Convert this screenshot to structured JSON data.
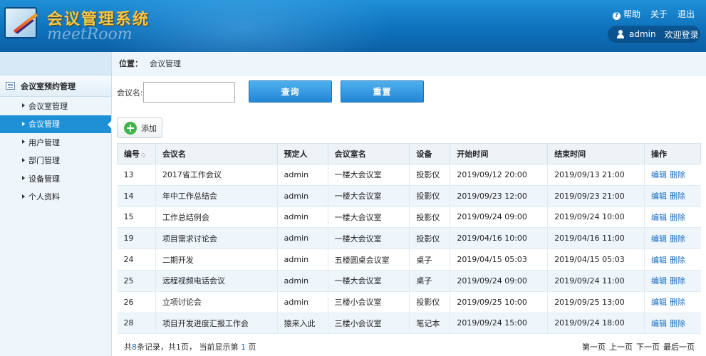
{
  "header": {
    "title": "会议管理系统",
    "subtitle": "meetRoom",
    "help": "帮助",
    "about": "关于",
    "logout": "退出",
    "username": "admin",
    "welcome": "欢迎登录"
  },
  "sidebar": {
    "section": "会议室预约管理",
    "items": [
      {
        "label": "会议室管理"
      },
      {
        "label": "会议管理",
        "active": true
      },
      {
        "label": "用户管理"
      },
      {
        "label": "部门管理"
      },
      {
        "label": "设备管理"
      },
      {
        "label": "个人资料"
      }
    ]
  },
  "main": {
    "crumb_label": "位置：",
    "crumb_value": "会议管理",
    "search_label": "会议名:",
    "search_value": "",
    "query_button": "查询",
    "reset_button": "重置",
    "add_button": "添加"
  },
  "table": {
    "headers": [
      "编号",
      "会议名",
      "预定人",
      "会议室名",
      "设备",
      "开始时间",
      "结束时间",
      "操作"
    ],
    "rows": [
      [
        "13",
        "2017省工作会议",
        "admin",
        "一楼大会议室",
        "投影仪",
        "2019/09/12 20:00",
        "2019/09/13 21:00"
      ],
      [
        "14",
        "年中工作总结会",
        "admin",
        "一楼大会议室",
        "投影仪",
        "2019/09/23 12:00",
        "2019/09/23 21:00"
      ],
      [
        "15",
        "工作总结例会",
        "admin",
        "一楼大会议室",
        "投影仪",
        "2019/09/24 09:00",
        "2019/09/24 10:00"
      ],
      [
        "19",
        "项目需求讨论会",
        "admin",
        "一楼大会议室",
        "投影仪",
        "2019/04/16 10:00",
        "2019/04/16 11:00"
      ],
      [
        "24",
        "二期开发",
        "admin",
        "五楼圆桌会议室",
        "桌子",
        "2019/04/15 05:03",
        "2019/04/15 05:03"
      ],
      [
        "25",
        "远程视频电话会议",
        "admin",
        "一楼大会议室",
        "桌子",
        "2019/09/24 09:00",
        "2019/09/24 11:00"
      ],
      [
        "26",
        "立项讨论会",
        "admin",
        "三楼小会议室",
        "投影仪",
        "2019/09/25 10:00",
        "2019/09/25 13:00"
      ],
      [
        "28",
        "项目开发进度汇报工作会",
        "猿来入此",
        "三楼小会议室",
        "笔记本",
        "2019/09/24 15:00",
        "2019/09/24 18:00"
      ]
    ],
    "edit_label": "编辑",
    "delete_label": "删除"
  },
  "pager": {
    "summary_prefix": "共",
    "total": "8",
    "summary_mid": "条记录，共1页，",
    "current_prefix": "当前显示第",
    "current": "1",
    "current_suffix": "页",
    "first": "第一页",
    "prev": "上一页",
    "next": "下一页",
    "last": "最后一页"
  },
  "colors": {
    "accent": "#1e90d6",
    "link": "#1a6fc1",
    "title": "#f5c64a"
  }
}
